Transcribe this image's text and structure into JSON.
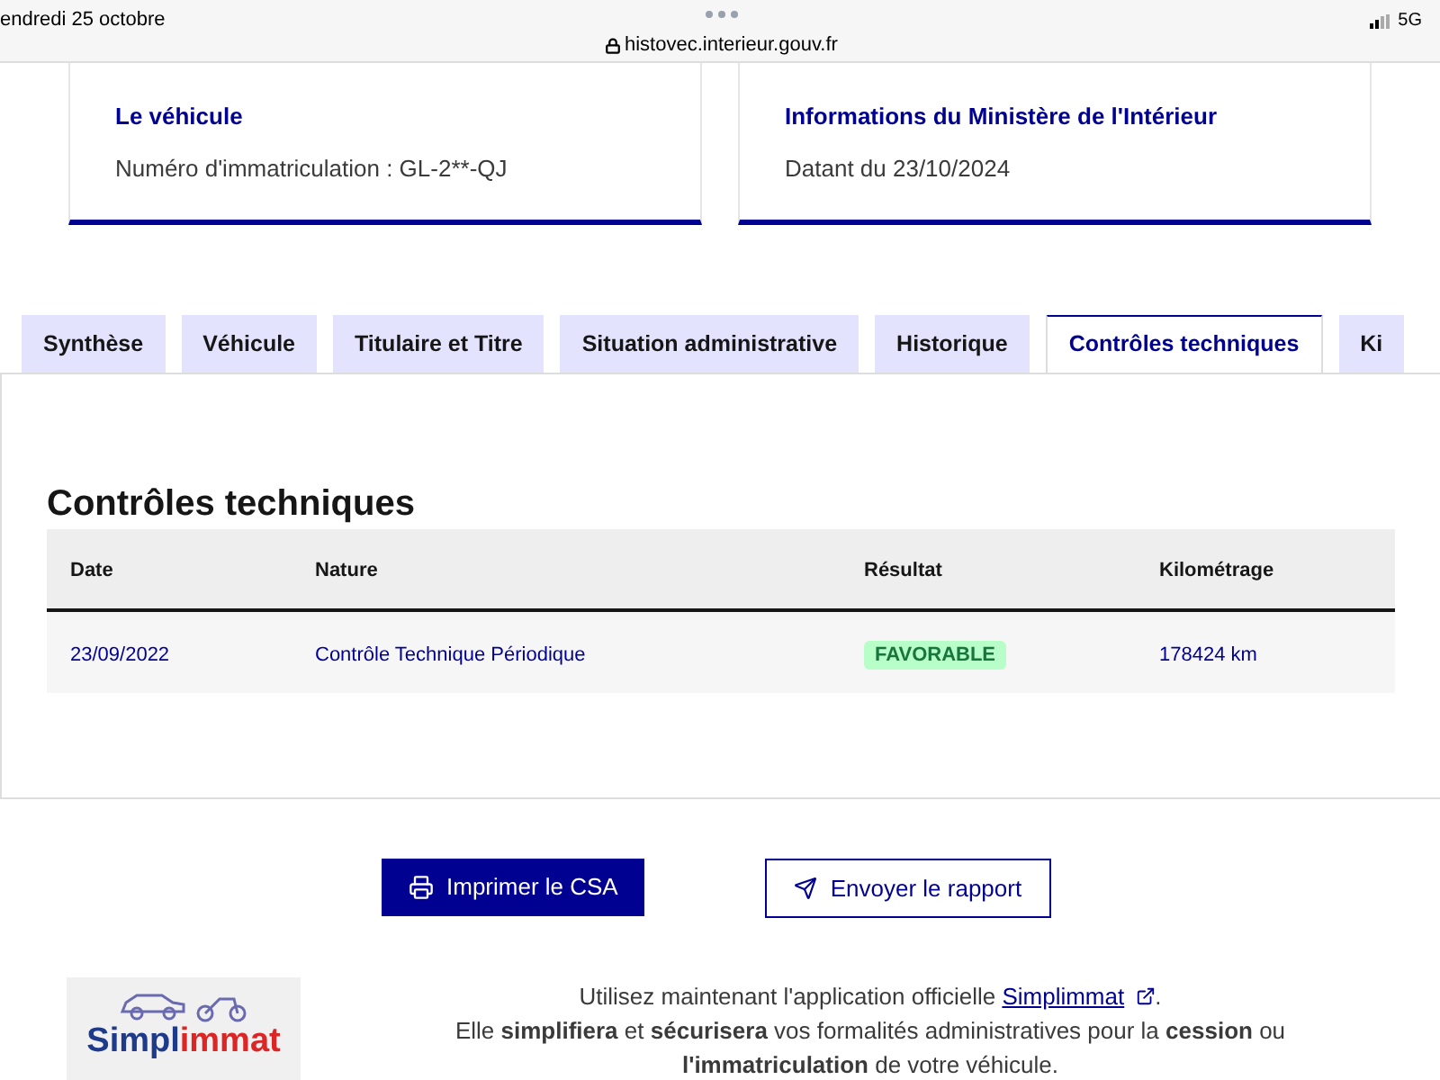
{
  "status_bar": {
    "date": "endredi 25 octobre",
    "url": "histovec.interieur.gouv.fr",
    "network": "5G"
  },
  "cards": [
    {
      "title": "Le véhicule",
      "text": "Numéro d'immatriculation : GL-2**-QJ"
    },
    {
      "title": "Informations du Ministère de l'Intérieur",
      "text": "Datant du 23/10/2024"
    }
  ],
  "tabs": [
    {
      "label": "Synthèse",
      "selected": false
    },
    {
      "label": "Véhicule",
      "selected": false
    },
    {
      "label": "Titulaire et Titre",
      "selected": false
    },
    {
      "label": "Situation administrative",
      "selected": false
    },
    {
      "label": "Historique",
      "selected": false
    },
    {
      "label": "Contrôles techniques",
      "selected": true
    },
    {
      "label": "Ki",
      "selected": false
    }
  ],
  "section_title": "Contrôles techniques",
  "table": {
    "columns": [
      "Date",
      "Nature",
      "Résultat",
      "Kilométrage"
    ],
    "rows": [
      {
        "date": "23/09/2022",
        "nature": "Contrôle Technique Périodique",
        "result": "FAVORABLE",
        "mileage": "178424 km"
      }
    ]
  },
  "buttons": [
    {
      "label": "Imprimer le CSA",
      "kind": "primary"
    },
    {
      "label": "Envoyer le rapport",
      "kind": "secondary"
    }
  ],
  "logo": {
    "part_1": "Simpl",
    "part_2": "immat"
  },
  "promo": {
    "line_1": "Utilisez maintenant l'application officielle",
    "link": "Simplimmat",
    "line_1_end": ".",
    "line_2": "Elle **simplifiera** et **sécurisera** vos formalités administratives pour la **cession** ou",
    "line_3": "**l'immatriculation** de votre véhicule."
  }
}
